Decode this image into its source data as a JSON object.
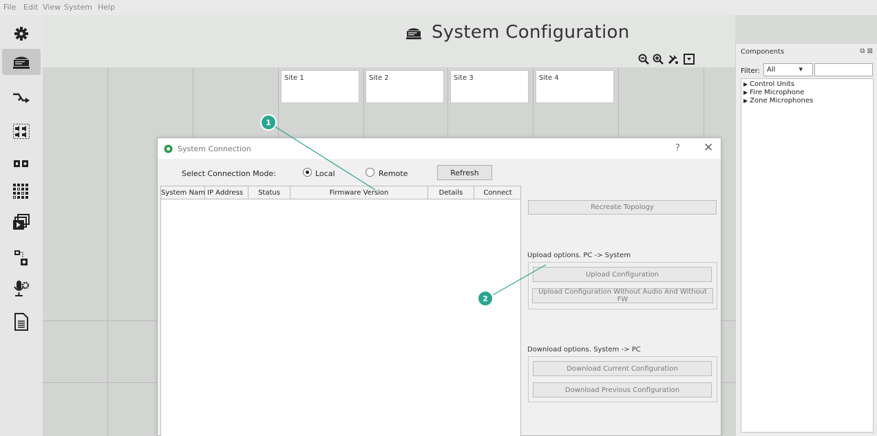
{
  "menu": [
    "File",
    "Edit",
    "View",
    "System",
    "Help"
  ],
  "toolbar": {
    "icons": [
      "gear-icon",
      "system-unit-icon",
      "routing-arrow-icon",
      "speakers-icon",
      "io-icon",
      "matrix-icon",
      "media-playback-icon",
      "network-device-icon",
      "microphone-settings-icon",
      "document-icon"
    ],
    "active": "system-unit-icon"
  },
  "page": {
    "title": "System Configuration"
  },
  "sites": [
    "Site 1",
    "Site 2",
    "Site 3",
    "Site 4"
  ],
  "components": {
    "title": "Components",
    "filter_label": "Filter:",
    "filter_value": "All",
    "tree": [
      "Control Units",
      "Fire Microphone",
      "Zone Microphones"
    ]
  },
  "dialog": {
    "title": "System Connection",
    "help": "?",
    "close": "✕",
    "mode_label": "Select Connection Mode:",
    "mode_local": "Local",
    "mode_remote": "Remote",
    "mode_selected": "Local",
    "refresh": "Refresh",
    "columns": [
      "System Name",
      "IP Address",
      "Status",
      "Firmware Version",
      "Details",
      "Connect"
    ],
    "recreate_topology": "Recreate Topology",
    "upload_label": "Upload options. PC -> System",
    "upload_config": "Upload Configuration",
    "upload_no_audio": "Upload Configuration Without Audio And Without FW",
    "download_label": "Download options. System -> PC",
    "download_current": "Download Current Configuration",
    "download_previous": "Download Previous Configuration"
  },
  "callouts": [
    "1",
    "2"
  ],
  "colors": {
    "callout": "#2ba590",
    "canvas": "#d3d5d3"
  }
}
